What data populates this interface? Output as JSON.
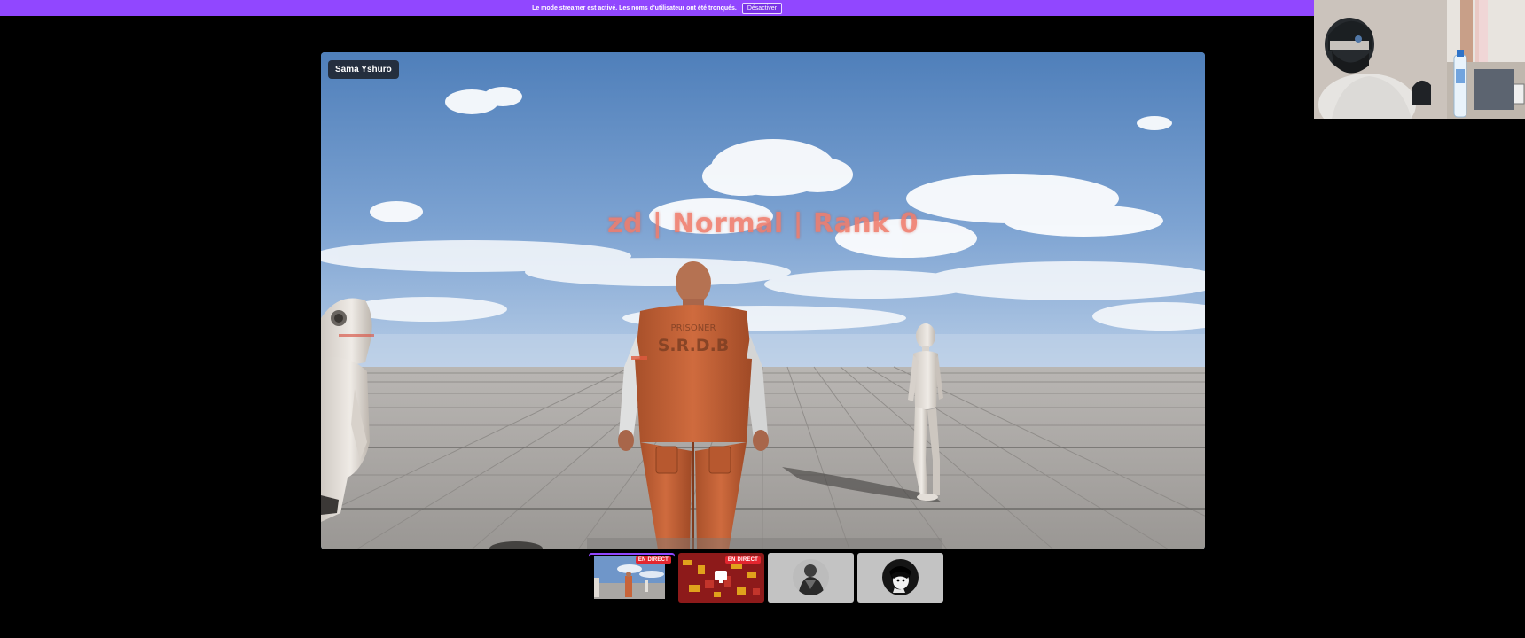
{
  "banner": {
    "message": "Le mode streamer est activé. Les noms d'utilisateur ont été tronqués.",
    "button_label": "Désactiver",
    "color": "#9147ff"
  },
  "stream": {
    "streamer_name": "Sama Yshuro",
    "overhead_label": "zd | Normal | Rank 0",
    "prisoner_top_text": "PRISONER",
    "prisoner_back_text": "S.R.D.B"
  },
  "thumbnails": [
    {
      "name": "participant-1",
      "badge": "EN DIRECT",
      "active": true
    },
    {
      "name": "participant-2",
      "badge": "EN DIRECT",
      "active": false
    },
    {
      "name": "participant-3",
      "badge": "",
      "active": false
    },
    {
      "name": "participant-4",
      "badge": "",
      "active": false
    }
  ],
  "colors": {
    "accent": "#9147ff",
    "live": "#e3262f",
    "prison_orange": "#c8643a"
  }
}
